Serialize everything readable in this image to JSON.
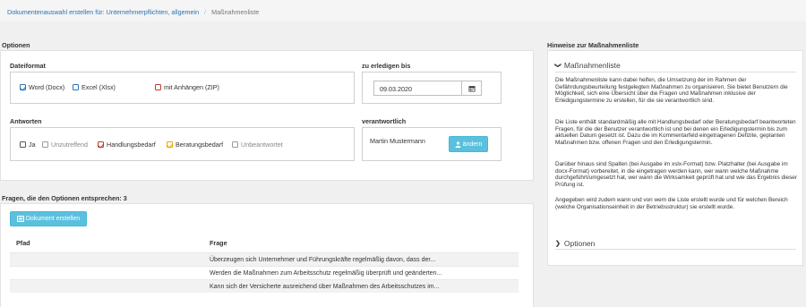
{
  "breadcrumb": {
    "link": "Dokumentenauswahl erstellen für: Unternehmerpflichten, allgemein",
    "separator": "/",
    "current": "Maßnahmenliste"
  },
  "options": {
    "title": "Optionen",
    "dateiformat": {
      "label": "Dateiformat",
      "items": [
        {
          "label": "Word (Docx)",
          "checked": true,
          "color": "#2a72b5"
        },
        {
          "label": "Excel (Xlsx)",
          "checked": false,
          "color": "#2a72b5"
        },
        {
          "label": "mit Anhängen (ZIP)",
          "checked": false,
          "color": "#c0392b"
        }
      ]
    },
    "erledigen": {
      "label": "zu erledigen bis",
      "date": "09.03.2020",
      "icon": "calendar-icon"
    },
    "antworten": {
      "label": "Antworten",
      "items": [
        {
          "label": "Ja",
          "checked": false
        },
        {
          "label": "Unzutreffend",
          "checked": false
        },
        {
          "label": "Handlungsbedarf",
          "checked": true,
          "color": "#c0392b"
        },
        {
          "label": "Beratungsbedarf",
          "checked": true,
          "color": "#e5a800"
        },
        {
          "label": "Unbeantwortet",
          "checked": false
        }
      ]
    },
    "verantwortlich": {
      "label": "verantwortlich",
      "name": "Martin Mustermann",
      "button": "ändern",
      "icon": "user-icon"
    }
  },
  "questions": {
    "title": "Fragen, die den Optionen entsprechen: 3",
    "button": "Dokument erstellen",
    "button_icon": "document-icon",
    "columns": [
      "Pfad",
      "Frage"
    ],
    "rows": [
      {
        "pfad": "",
        "frage": "Überzeugen sich Unternehmer und Führungskräfte regelmäßig davon, dass der..."
      },
      {
        "pfad": "",
        "frage": "Werden die Maßnahmen zum Arbeitsschutz regelmäßig überprüft und geänderten..."
      },
      {
        "pfad": "",
        "frage": "Kann sich der Versicherte ausreichend über Maßnahmen des Arbeitsschutzes im..."
      }
    ]
  },
  "hints": {
    "title": "Hinweise zur Maßnahmenliste",
    "section1": "Maßnahmenliste",
    "paragraphs": [
      "Die Maßnahmenliste kann dabei helfen, die Umsetzung der im Rahmen der Gefährdungsbeurteilung festgelegten Maßnahmen zu organisieren. Sie bietet Benutzern die Möglichkeit, sich eine Übersicht über die Fragen und Maßnahmen inklusive der Erledigungstermine zu erstellen, für die sie verantwortlich sind.",
      "Die Liste enthält standardmäßig alle mit Handlungsbedarf oder Beratungsbedarf beantworteten Fragen, für die der Benutzer verantwortlich ist und bei denen ein Erledigungstermin bis zum aktuellen Datum gesetzt ist. Dazu die im Kommentarfeld eingetragenen Defizite, geplanten Maßnahmen bzw. offenen Fragen und den Erledigungstermin.",
      "Darüber hinaus sind Spalten (bei Ausgabe im xslx-Format) bzw. Platzhalter (bei Ausgabe im docx-Format) vorbereitet, in die eingetragen werden kann, wer wann welche Maßnahme durchgeführt/umgesetzt hat, wer wann die Wirksamkeit geprüft hat und wie das Ergebnis dieser Prüfung ist.",
      "Angegeben wird zudem wann und von wem die Liste erstellt wurde und für welchen Bereich (welche Organisationseinheit in der Betriebsstruktur) sie erstellt wurde."
    ],
    "section2": "Optionen"
  }
}
